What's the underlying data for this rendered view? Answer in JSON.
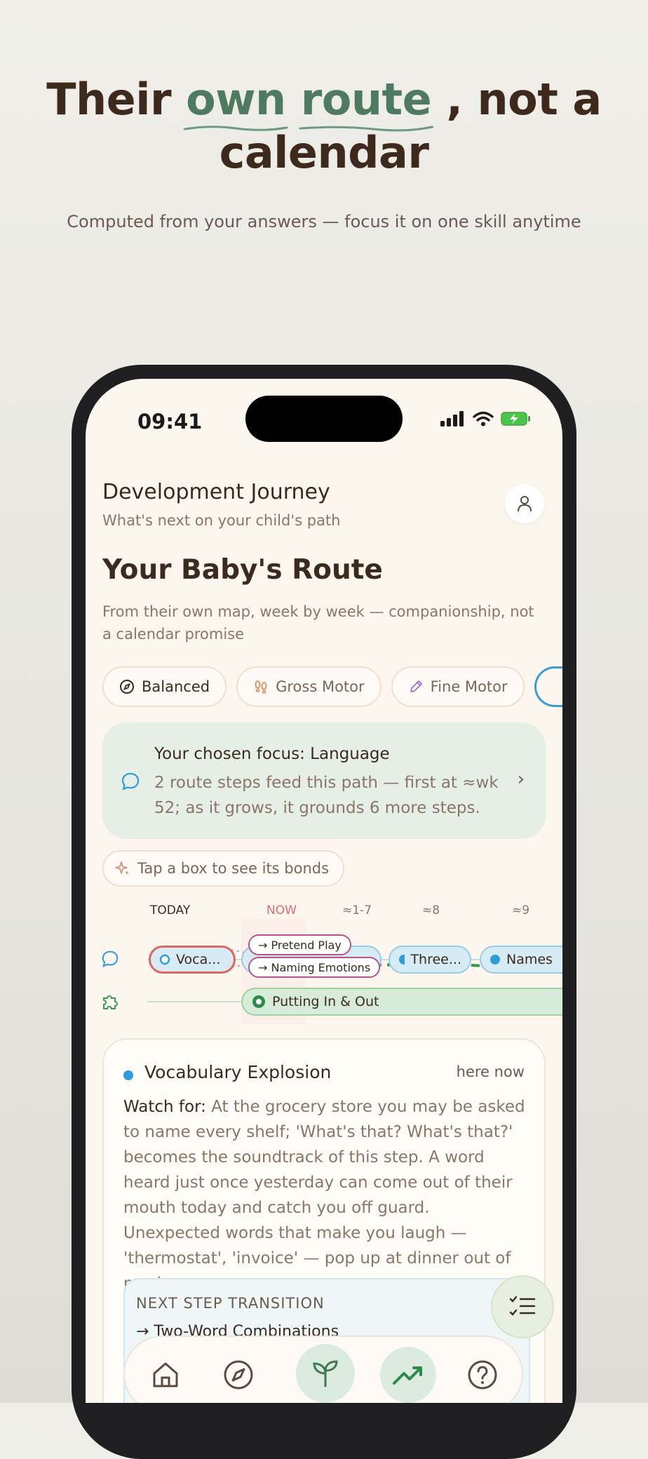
{
  "hero": {
    "headline_part1": "Their ",
    "headline_green1": "own",
    "headline_space": " ",
    "headline_green2": "route",
    "headline_part2": " , not a",
    "headline_line2": "calendar",
    "subline": "Computed from your answers — focus it on one skill anytime"
  },
  "status_bar": {
    "time": "09:41"
  },
  "header": {
    "title": "Development Journey",
    "subtitle": "What's next on your child's path"
  },
  "route": {
    "title": "Your Baby's Route",
    "description": "From their own map, week by week — companionship, not a calendar promise"
  },
  "chips": [
    {
      "label": "Balanced",
      "icon": "compass-icon"
    },
    {
      "label": "Gross Motor",
      "icon": "footprints-icon"
    },
    {
      "label": "Fine Motor",
      "icon": "pencil-icon"
    }
  ],
  "focus_card": {
    "line1": "Your chosen focus: Language",
    "line2": "2 route steps feed this path — first at ≈wk 52; as it grows, it grounds 6 more steps."
  },
  "tap_hint": "Tap a box to see its bonds",
  "timeline": {
    "headers": [
      "TODAY",
      "NOW",
      "≈1-7",
      "≈8",
      "≈9"
    ],
    "language_nodes": [
      "Voca...",
      "Three...",
      "Names"
    ],
    "bubbles": [
      "→ Pretend Play",
      "→ Naming Emotions"
    ],
    "fine_motor_node": "Putting In & Out",
    "colors": {
      "language": "#2f9bd9",
      "fine_motor": "#3e9a58",
      "bond": "#b7548a"
    }
  },
  "detail": {
    "title": "Vocabulary Explosion",
    "status": "here now",
    "watch_label": "Watch for:",
    "watch_text": " At the grocery store you may be asked to name every shelf; 'What's that? What's that?' becomes the soundtrack of this step. A word heard just once yesterday can come out of their mouth today and catch you off guard. Unexpected words that make you laugh — 'thermostat', 'invoice' — pop up at dinner out of nowhere.",
    "next_label": "NEXT STEP TRANSITION",
    "next_value": "→ Two-Word Combinations"
  },
  "tabbar": {
    "tabs": [
      "home-icon",
      "compass-icon",
      "sprout-icon",
      "trending-up-icon",
      "help-icon"
    ],
    "active": "trending-up-icon"
  }
}
